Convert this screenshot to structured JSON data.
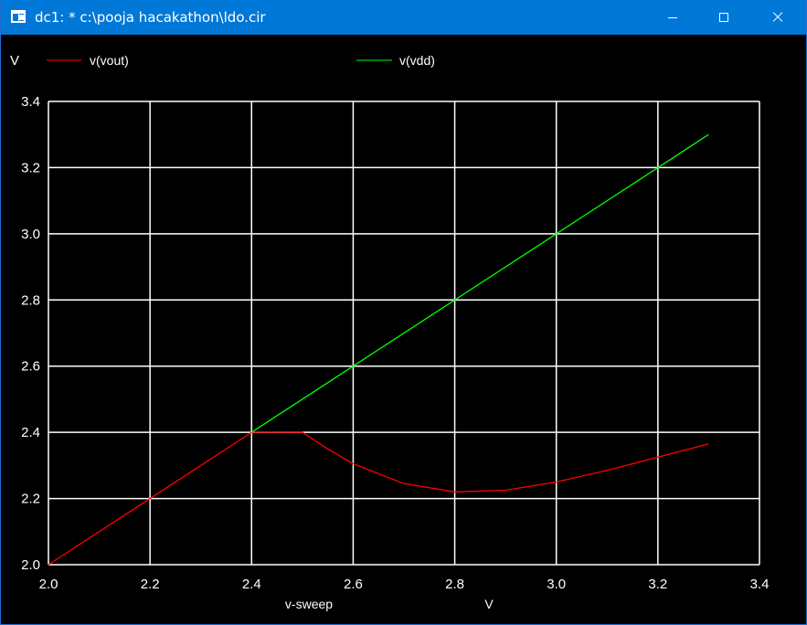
{
  "window": {
    "title": "dc1: * c:\\pooja hacakathon\\ldo.cir"
  },
  "legend": {
    "y_unit": "V",
    "entries": [
      {
        "label": "v(vout)",
        "color": "#ff0000"
      },
      {
        "label": "v(vdd)",
        "color": "#00ff00"
      }
    ]
  },
  "chart_data": {
    "type": "line",
    "xlabel": "v-sweep",
    "xunit": "V",
    "ylabel": "V",
    "xlim": [
      2.0,
      3.4
    ],
    "ylim": [
      2.0,
      3.4
    ],
    "xticks": [
      "2.0",
      "2.2",
      "2.4",
      "2.6",
      "2.8",
      "3.0",
      "3.2",
      "3.4"
    ],
    "yticks": [
      "2.0",
      "2.2",
      "2.4",
      "2.6",
      "2.8",
      "3.0",
      "3.2",
      "3.4"
    ],
    "grid": true,
    "background": "#000000",
    "grid_color": "#ffffff",
    "series": [
      {
        "name": "v(vout)",
        "color": "#ff0000",
        "x": [
          2.0,
          2.1,
          2.2,
          2.3,
          2.4,
          2.45,
          2.5,
          2.55,
          2.6,
          2.7,
          2.8,
          2.9,
          3.0,
          3.1,
          3.2,
          3.3
        ],
        "y": [
          2.0,
          2.1,
          2.2,
          2.3,
          2.4,
          2.4,
          2.4,
          2.35,
          2.305,
          2.245,
          2.22,
          2.225,
          2.25,
          2.285,
          2.325,
          2.365
        ]
      },
      {
        "name": "v(vdd)",
        "color": "#00ff00",
        "x": [
          2.4,
          2.6,
          2.8,
          3.0,
          3.2,
          3.3
        ],
        "y": [
          2.4,
          2.6,
          2.8,
          3.0,
          3.2,
          3.3
        ]
      }
    ]
  }
}
